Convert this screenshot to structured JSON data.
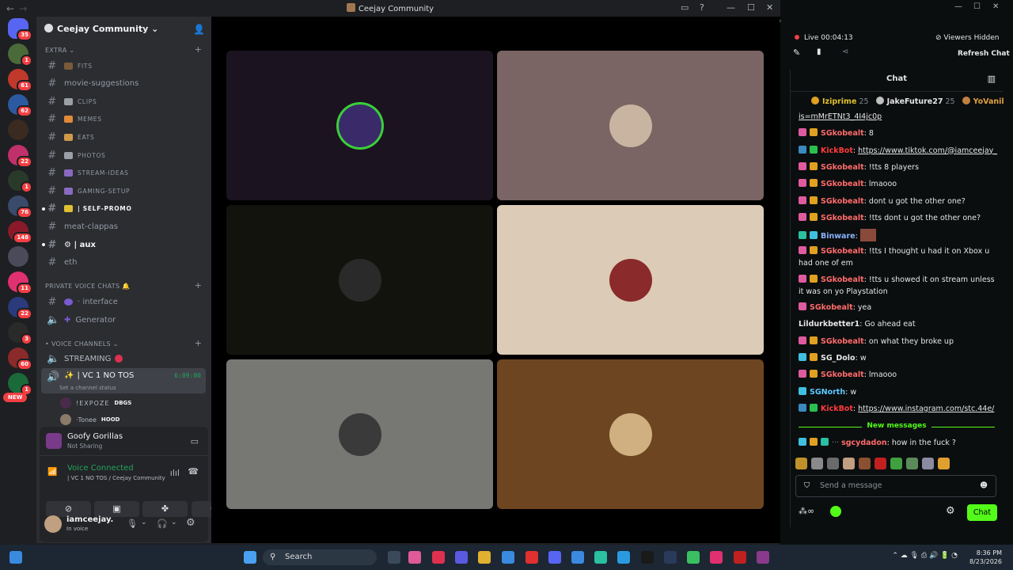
{
  "window": {
    "title": "Ceejay Community"
  },
  "servers": [
    {
      "badge": "35",
      "color": "#5865f2"
    },
    {
      "badge": "1",
      "color": "#4a6a3a"
    },
    {
      "badge": "61",
      "color": "#c0392b"
    },
    {
      "badge": "62",
      "color": "#2c5aa0"
    },
    {
      "badge": "",
      "color": "#3a2a20"
    },
    {
      "badge": "22",
      "color": "#c0306a"
    },
    {
      "badge": "1",
      "color": "#2a3a2a"
    },
    {
      "badge": "76",
      "color": "#3a4a6a"
    },
    {
      "badge": "148",
      "color": "#8a1a2a"
    },
    {
      "badge": "",
      "color": "#4a4a5a"
    },
    {
      "badge": "11",
      "color": "#e03070"
    },
    {
      "badge": "22",
      "color": "#2a3a7a"
    },
    {
      "badge": "3",
      "color": "#2a2a2a"
    },
    {
      "badge": "60",
      "color": "#8a2a2a"
    },
    {
      "badge": "1",
      "color": "#1a6a3a"
    }
  ],
  "rail_new": "NEW",
  "guild": {
    "name": "Ceejay Community"
  },
  "categories": {
    "extra": "EXTRA",
    "private": "PRIVATE VOICE CHATS",
    "voice": "• VOICE CHANNELS"
  },
  "channels": [
    {
      "name": "FITS",
      "emoji": "#7a5a3a",
      "small": true,
      "bold": false,
      "unread": false
    },
    {
      "name": "movie-suggestions",
      "emoji": "",
      "small": false,
      "bold": false,
      "unread": false
    },
    {
      "name": "CLIPS",
      "emoji": "#9aa0a6",
      "small": true,
      "bold": false,
      "unread": false
    },
    {
      "name": "MEMES",
      "emoji": "#e08a3a",
      "small": true,
      "bold": false,
      "unread": false
    },
    {
      "name": "EATS",
      "emoji": "#d09a4a",
      "small": true,
      "bold": false,
      "unread": false
    },
    {
      "name": "PHOTOS",
      "emoji": "#9aa0a6",
      "small": true,
      "bold": false,
      "unread": false
    },
    {
      "name": "STREAM-IDEAS",
      "emoji": "#8a6ac0",
      "small": true,
      "bold": false,
      "unread": false
    },
    {
      "name": "GAMING-SETUP",
      "emoji": "#8a6ac0",
      "small": true,
      "bold": false,
      "unread": false
    },
    {
      "name": "| SELF-PROMO",
      "emoji": "#e0c030",
      "small": true,
      "bold": true,
      "unread": true
    },
    {
      "name": "meat-clappas",
      "emoji": "",
      "small": false,
      "bold": false,
      "unread": false
    },
    {
      "name": "⚙ | aux",
      "emoji": "",
      "small": false,
      "bold": true,
      "unread": true
    },
    {
      "name": "eth",
      "emoji": "",
      "small": false,
      "bold": false,
      "unread": false
    }
  ],
  "private_channels": [
    {
      "name": "· interface",
      "icon": "hash"
    },
    {
      "name": "Generator",
      "icon": "speaker"
    }
  ],
  "voice": {
    "streaming": "STREAMING",
    "vc_name": "| VC 1 NO TOS",
    "vc_timer": "6:09:00",
    "vc_status": "Set a channel status",
    "users": [
      {
        "name": "!EXPOZE",
        "tag": "DBGS"
      },
      {
        "name": "·Tonee",
        "tag": "HOOD"
      }
    ]
  },
  "activity": {
    "title": "Goofy Gorillas",
    "subtitle": "Not Sharing"
  },
  "connection": {
    "status": "Voice Connected",
    "detail": "| VC 1 NO TOS / Ceejay Community"
  },
  "user": {
    "name": "iamceejay.",
    "status": "In voice"
  },
  "tiles": [
    {
      "bg": "#1c1320",
      "avatar": "#3a2a6a",
      "ring": "#3ad03a"
    },
    {
      "bg": "#7a6464",
      "avatar": "#c8b4a0",
      "ring": ""
    },
    {
      "bg": "#13130d",
      "avatar": "#2a2a2a",
      "ring": ""
    },
    {
      "bg": "#dccbb6",
      "avatar": "#8a2a2a",
      "ring": ""
    },
    {
      "bg": "#777774",
      "avatar": "#3a3a3a",
      "ring": ""
    },
    {
      "bg": "#6d4520",
      "avatar": "#d0b080",
      "ring": ""
    }
  ],
  "taskbar": {
    "search": "Search",
    "time": "8:36 PM",
    "date": "8/23/2026"
  },
  "kick": {
    "live": "Live 00:04:13",
    "viewers_hidden": "Viewers Hidden",
    "refresh": "Refresh Chat",
    "chat_title": "Chat",
    "top_gifters": [
      {
        "name": "Iziprime",
        "count": "25"
      },
      {
        "name": "JakeFuture27",
        "count": "25"
      },
      {
        "name": "YoVanil",
        "count": ""
      }
    ],
    "messages": [
      {
        "user": "",
        "color": "#e6e6e6",
        "text": "is=mMrETNt3_4I4jc0p",
        "link": true,
        "badges": []
      },
      {
        "user": "SGkobealt",
        "color": "#ff6b6b",
        "text": "8",
        "link": false,
        "badges": [
          "#e05aa0",
          "#e0a020"
        ]
      },
      {
        "user": "KickBot",
        "color": "#ff3b3b",
        "text": "https://www.tiktok.com/@iamceejay_",
        "link": true,
        "badges": [
          "#3a8ac0",
          "#2ac050"
        ]
      },
      {
        "user": "SGkobealt",
        "color": "#ff6b6b",
        "text": "!tts 8 players",
        "link": false,
        "badges": [
          "#e05aa0",
          "#e0a020"
        ]
      },
      {
        "user": "SGkobealt",
        "color": "#ff6b6b",
        "text": "lmaooo",
        "link": false,
        "badges": [
          "#e05aa0",
          "#e0a020"
        ]
      },
      {
        "user": "SGkobealt",
        "color": "#ff6b6b",
        "text": "dont u got the other one?",
        "link": false,
        "badges": [
          "#e05aa0",
          "#e0a020"
        ]
      },
      {
        "user": "SGkobealt",
        "color": "#ff6b6b",
        "text": "!tts dont u got the other one?",
        "link": false,
        "badges": [
          "#e05aa0",
          "#e0a020"
        ]
      },
      {
        "user": "Binware",
        "color": "#8ab4ff",
        "text": "",
        "link": false,
        "badges": [
          "#2ac0a0",
          "#40c0e0"
        ]
      },
      {
        "user": "SGkobealt",
        "color": "#ff6b6b",
        "text": "!tts I thought u had it on Xbox u had one of em",
        "link": false,
        "badges": [
          "#e05aa0",
          "#e0a020"
        ]
      },
      {
        "user": "SGkobealt",
        "color": "#ff6b6b",
        "text": "!tts u showed it on stream unless it was on yo Playstation",
        "link": false,
        "badges": [
          "#e05aa0",
          "#e0a020"
        ]
      },
      {
        "user": "SGkobealt",
        "color": "#ff6b6b",
        "text": "yea",
        "link": false,
        "badges": [
          "#e05aa0"
        ]
      },
      {
        "user": "Lildurkbetter1",
        "color": "#e6e6e6",
        "text": "Go ahead eat",
        "link": false,
        "badges": []
      },
      {
        "user": "SGkobealt",
        "color": "#ff6b6b",
        "text": "on what they broke up",
        "link": false,
        "badges": [
          "#e05aa0",
          "#e0a020"
        ]
      },
      {
        "user": "SG_Dolo",
        "color": "#e6e6e6",
        "text": "w",
        "link": false,
        "badges": [
          "#40c0e0",
          "#e0a020"
        ]
      },
      {
        "user": "SGkobealt",
        "color": "#ff6b6b",
        "text": "lmaooo",
        "link": false,
        "badges": [
          "#e05aa0",
          "#e0a020"
        ]
      },
      {
        "user": "SGNorth",
        "color": "#5ac8ff",
        "text": "w",
        "link": false,
        "badges": [
          "#40c0e0"
        ]
      },
      {
        "user": "KickBot",
        "color": "#ff3b3b",
        "text": "https://www.instagram.com/stc.44e/",
        "link": true,
        "badges": [
          "#3a8ac0",
          "#2ac050"
        ]
      }
    ],
    "new_messages": "New messages",
    "last_message": {
      "user": "sgcydadon",
      "color": "#ff6b6b",
      "text": "how in the fuck ?"
    },
    "send_placeholder": "Send a message",
    "chat_button": "Chat"
  }
}
